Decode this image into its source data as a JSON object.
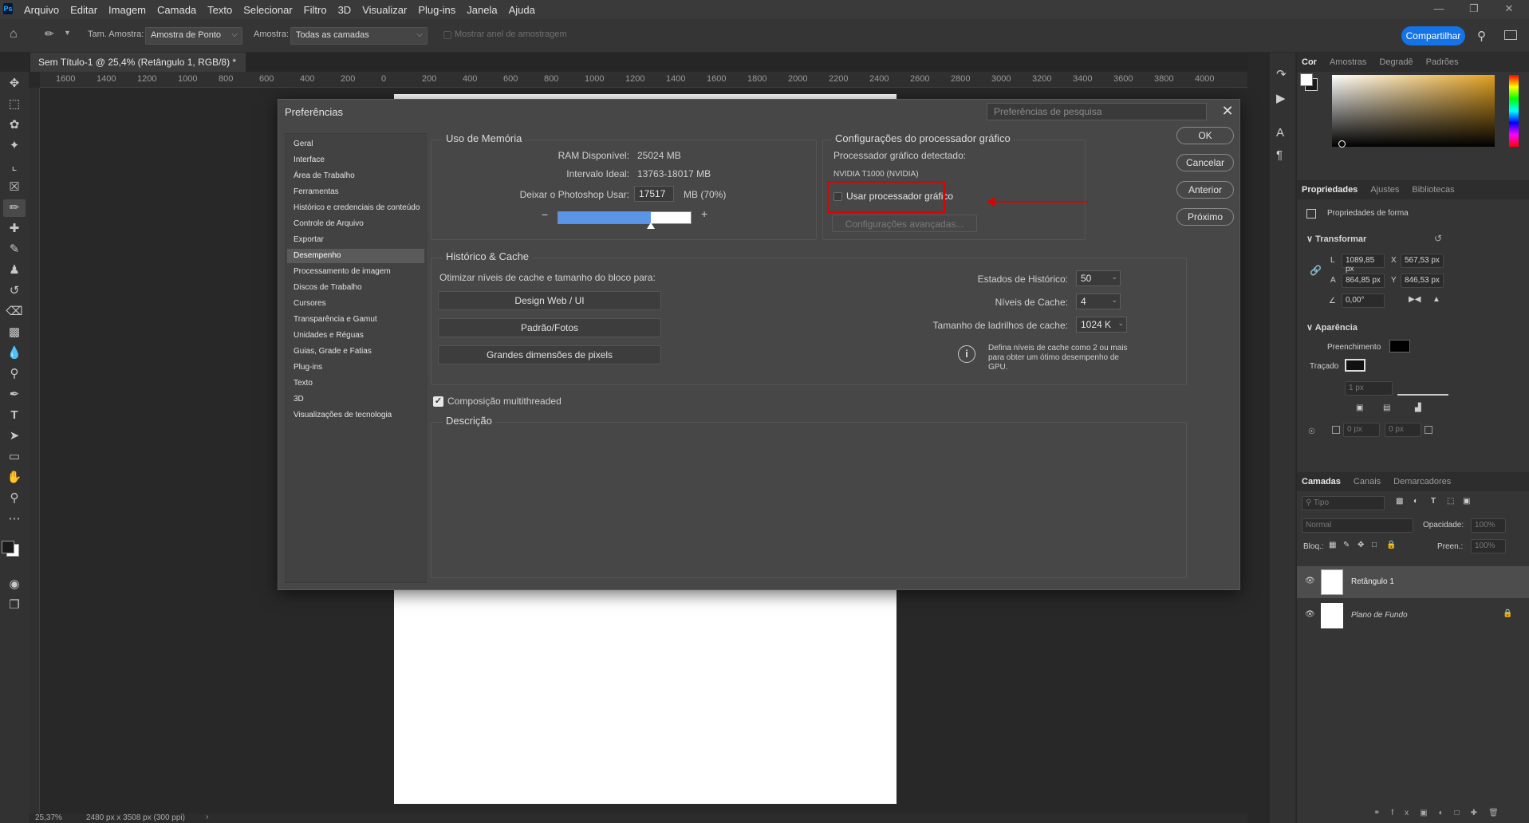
{
  "menu": {
    "logo": "Ps",
    "items": [
      "Arquivo",
      "Editar",
      "Imagem",
      "Camada",
      "Texto",
      "Selecionar",
      "Filtro",
      "3D",
      "Visualizar",
      "Plug-ins",
      "Janela",
      "Ajuda"
    ]
  },
  "options": {
    "sample_size_label": "Tam. Amostra:",
    "sample_size_value": "Amostra de Ponto",
    "sample_label": "Amostra:",
    "sample_value": "Todas as camadas",
    "show_ring": "Mostrar anel de amostragem",
    "share": "Compartilhar"
  },
  "document": {
    "tab_title": "Sem Título-1 @ 25,4% (Retângulo 1, RGB/8) *",
    "ruler_ticks": [
      "1600",
      "1400",
      "1200",
      "1000",
      "800",
      "600",
      "400",
      "200",
      "0",
      "200",
      "400",
      "600",
      "800",
      "1000",
      "1200",
      "1400",
      "1600",
      "1800",
      "2000",
      "2200",
      "2400",
      "2600",
      "2800",
      "3000",
      "3200",
      "3400",
      "3600",
      "3800",
      "4000"
    ],
    "zoom": "25,37%",
    "doc_info": "2480 px x 3508 px (300 ppi)"
  },
  "dialog": {
    "title": "Preferências",
    "search_placeholder": "Preferências de pesquisa",
    "categories": [
      "Geral",
      "Interface",
      "Área de Trabalho",
      "Ferramentas",
      "Histórico e credenciais de conteúdo",
      "Controle de Arquivo",
      "Exportar",
      "Desempenho",
      "Processamento de imagem",
      "Discos de Trabalho",
      "Cursores",
      "Transparência e Gamut",
      "Unidades e Réguas",
      "Guias, Grade e Fatias",
      "Plug-ins",
      "Texto",
      "3D",
      "Visualizações de tecnologia"
    ],
    "active_category": "Desempenho",
    "memory": {
      "title": "Uso de Memória",
      "ram_label": "RAM Disponível:",
      "ram_value": "25024 MB",
      "ideal_label": "Intervalo Ideal:",
      "ideal_value": "13763-18017 MB",
      "use_label": "Deixar o Photoshop Usar:",
      "use_value": "17517",
      "use_suffix": "MB (70%)",
      "slider_fraction": 0.7
    },
    "gpu": {
      "title": "Configurações do processador gráfico",
      "detected_label": "Processador gráfico detectado:",
      "detected_value": "NVIDIA T1000 (NVIDIA)",
      "use_gpu_label": "Usar processador gráfico",
      "use_gpu_checked": false,
      "advanced": "Configurações avançadas..."
    },
    "cache": {
      "title": "Histórico & Cache",
      "optimize_label": "Otimizar níveis de cache e tamanho do bloco para:",
      "btn1": "Design Web / UI",
      "btn2": "Padrão/Fotos",
      "btn3": "Grandes dimensões de pixels",
      "history_label": "Estados de Histórico:",
      "history_value": "50",
      "levels_label": "Níveis de Cache:",
      "levels_value": "4",
      "tile_label": "Tamanho de ladrilhos de cache:",
      "tile_value": "1024 K",
      "info": "Defina níveis de cache como 2 ou mais para obter um ótimo desempenho de GPU."
    },
    "multithread_label": "Composição multithreaded",
    "multithread_checked": true,
    "description_title": "Descrição",
    "buttons": {
      "ok": "OK",
      "cancel": "Cancelar",
      "prev": "Anterior",
      "next": "Próximo"
    }
  },
  "right_panel": {
    "color_tabs": [
      "Cor",
      "Amostras",
      "Degradê",
      "Padrões"
    ],
    "props_tabs": [
      "Propriedades",
      "Ajustes",
      "Bibliotecas"
    ],
    "shape_props": "Propriedades de forma",
    "transform": "Transformar",
    "w_label": "L",
    "w_value": "1089,85 px",
    "x_label": "X",
    "x_value": "567,53 px",
    "h_label": "A",
    "h_value": "864,85 px",
    "y_label": "Y",
    "y_value": "846,53 px",
    "angle_value": "0,00°",
    "appearance": "Aparência",
    "fill_label": "Preenchimento",
    "stroke_label": "Traçado",
    "stroke_size": "1 px",
    "corner1": "0 px",
    "corner2": "0 px",
    "layers_tabs": [
      "Camadas",
      "Canais",
      "Demarcadores"
    ],
    "layer_search": "Tipo",
    "blend_mode": "Normal",
    "opacity_label": "Opacidade:",
    "opacity_value": "100%",
    "lock_label": "Bloq.:",
    "fill2_label": "Preen.:",
    "fill2_value": "100%",
    "layers": [
      "Retângulo 1",
      "Plano de Fundo"
    ]
  },
  "colors": {
    "accent": "#1473e6",
    "highlight_box": "#e00000",
    "slider_fill": "#5b95e8"
  }
}
